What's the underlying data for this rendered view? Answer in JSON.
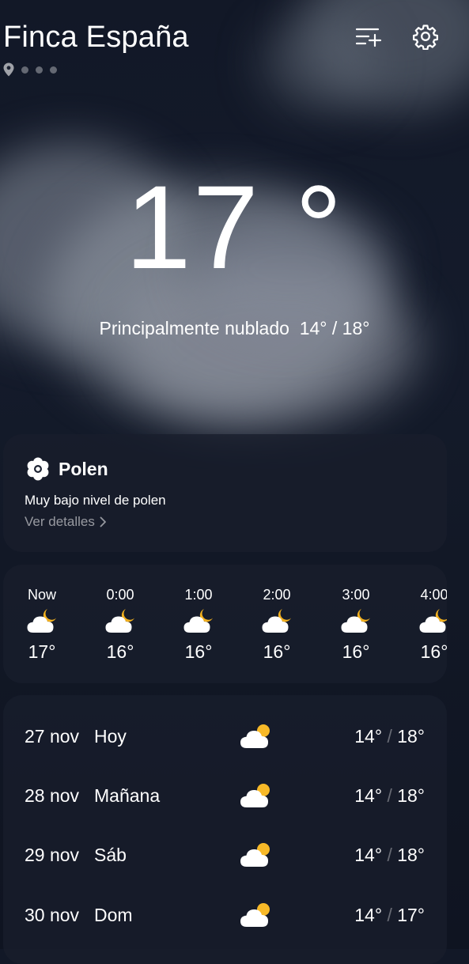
{
  "header": {
    "title": "Finca España",
    "location_icon": "location-pin-icon",
    "page_dots": 3,
    "add_city_icon": "add-city-list-icon",
    "settings_icon": "gear-icon"
  },
  "current": {
    "temperature": "17 °",
    "condition": "Principalmente nublado",
    "low_high": "14° / 18°"
  },
  "pollen": {
    "icon": "flower-icon",
    "title": "Polen",
    "description": "Muy bajo nivel de polen",
    "link": "Ver detalles"
  },
  "hourly": [
    {
      "time": "Now",
      "temp": "17°",
      "icon": "cloudy-night-icon"
    },
    {
      "time": "0:00",
      "temp": "16°",
      "icon": "cloudy-night-icon"
    },
    {
      "time": "1:00",
      "temp": "16°",
      "icon": "cloudy-night-icon"
    },
    {
      "time": "2:00",
      "temp": "16°",
      "icon": "cloudy-night-icon"
    },
    {
      "time": "3:00",
      "temp": "16°",
      "icon": "cloudy-night-icon"
    },
    {
      "time": "4:00",
      "temp": "16°",
      "icon": "cloudy-night-icon"
    }
  ],
  "daily": [
    {
      "date": "27 nov",
      "day": "Hoy",
      "low": "14°",
      "high": "18°",
      "icon": "partly-cloudy-icon"
    },
    {
      "date": "28 nov",
      "day": "Mañana",
      "low": "14°",
      "high": "18°",
      "icon": "partly-cloudy-icon"
    },
    {
      "date": "29 nov",
      "day": "Sáb",
      "low": "14°",
      "high": "18°",
      "icon": "partly-cloudy-icon"
    },
    {
      "date": "30 nov",
      "day": "Dom",
      "low": "14°",
      "high": "17°",
      "icon": "partly-cloudy-icon"
    }
  ],
  "colors": {
    "background": "#121827",
    "card": "#181e2c",
    "sun": "#f7b928",
    "moon": "#f2b01e",
    "cloud": "#ffffff"
  }
}
